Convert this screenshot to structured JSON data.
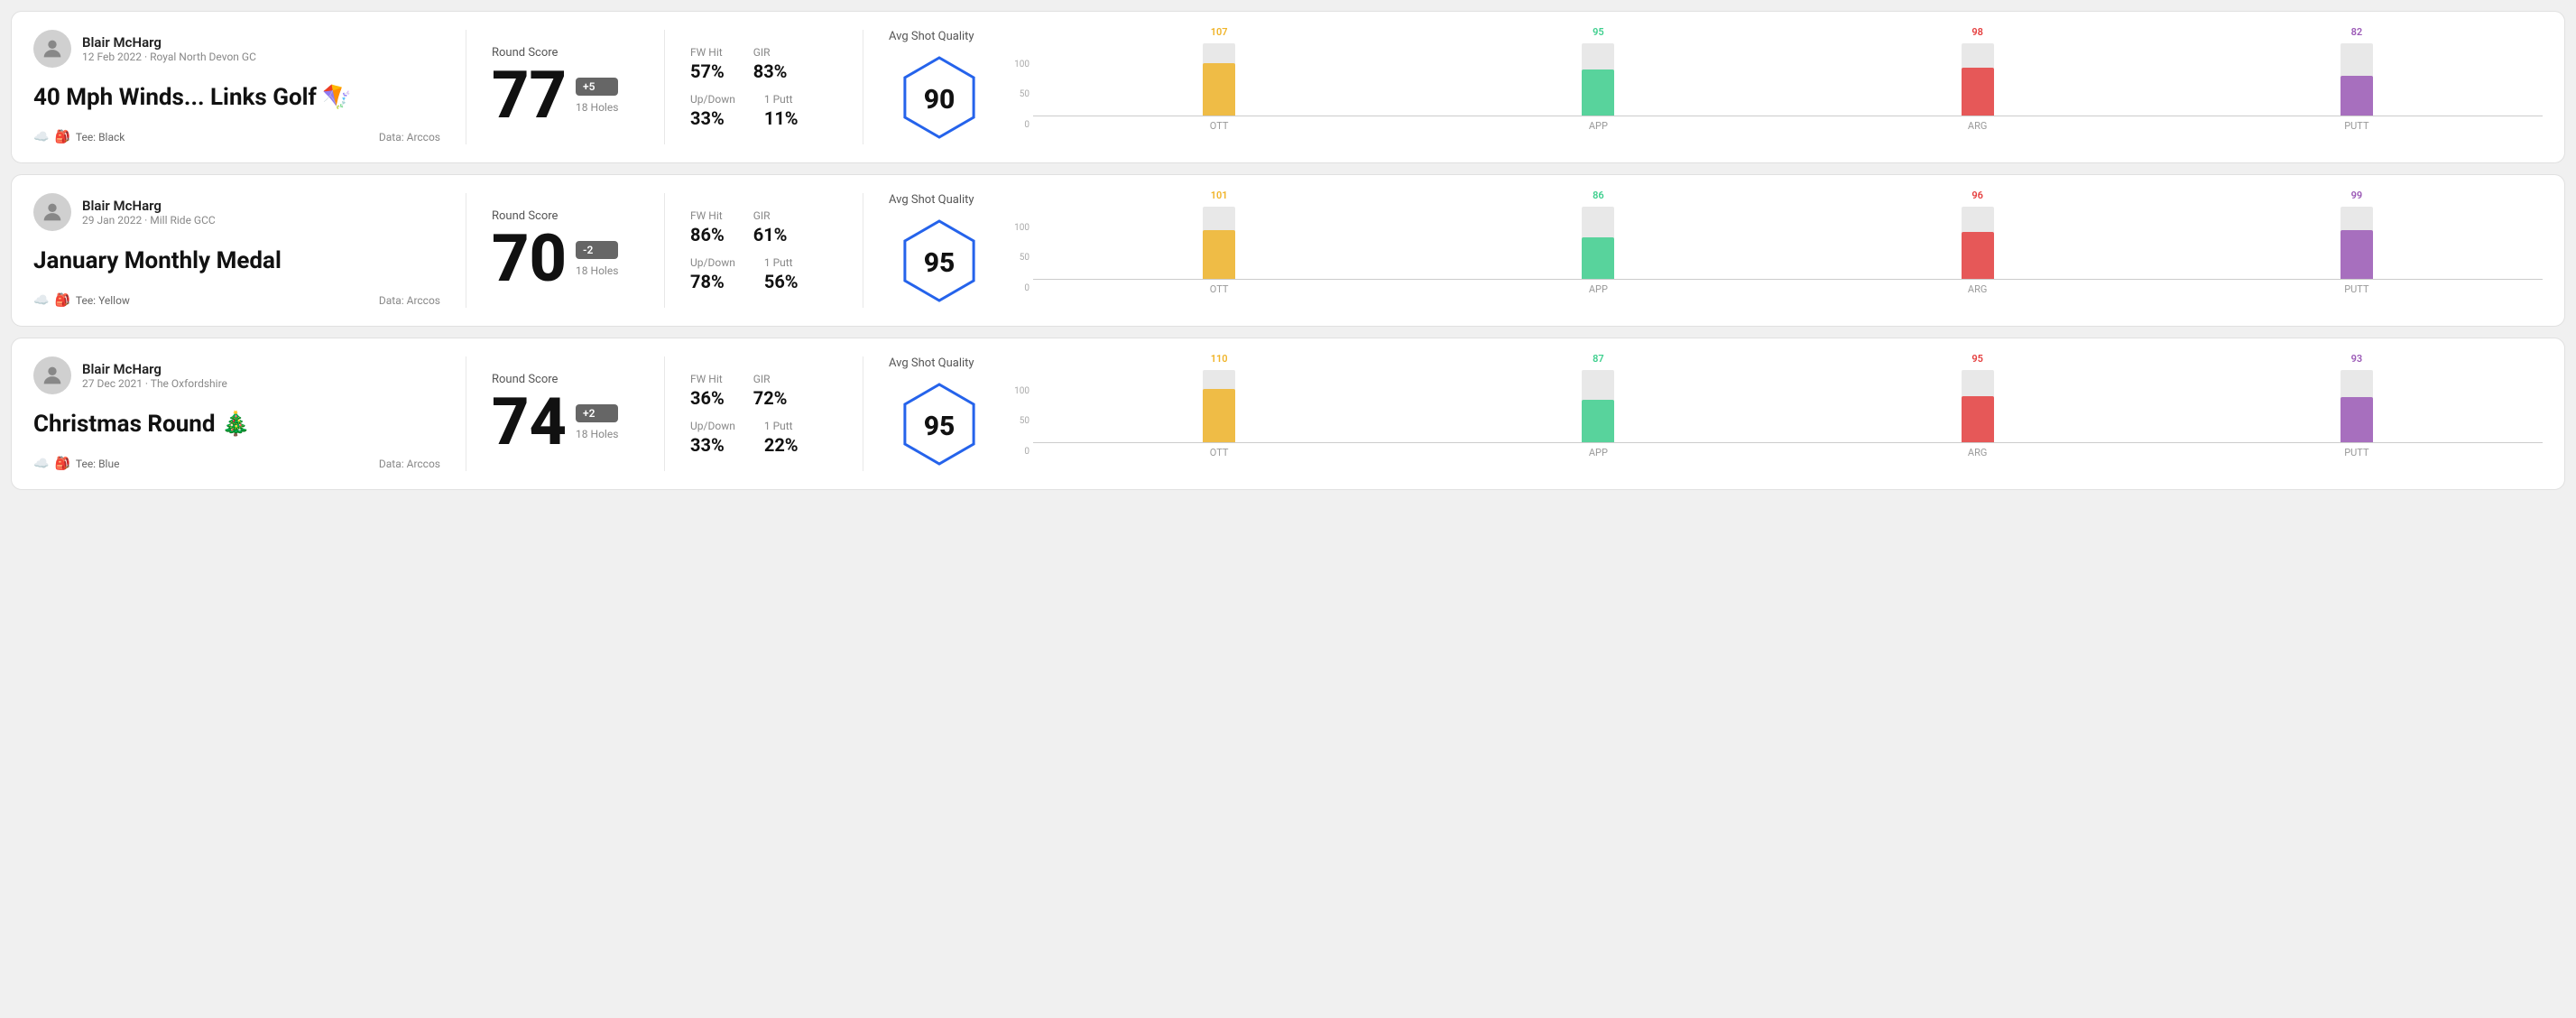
{
  "rounds": [
    {
      "id": "round1",
      "player": {
        "name": "Blair McHarg",
        "meta": "12 Feb 2022 · Royal North Devon GC"
      },
      "title": "40 Mph Winds... Links Golf",
      "title_emoji": "🪁",
      "tee": "Black",
      "data_source": "Data: Arccos",
      "score": {
        "label": "Round Score",
        "number": "77",
        "badge": "+5",
        "badge_type": "positive",
        "holes": "18 Holes"
      },
      "stats": {
        "fw_hit_label": "FW Hit",
        "fw_hit_value": "57%",
        "gir_label": "GIR",
        "gir_value": "83%",
        "updown_label": "Up/Down",
        "updown_value": "33%",
        "oneputt_label": "1 Putt",
        "oneputt_value": "11%"
      },
      "quality": {
        "label": "Avg Shot Quality",
        "score": "90"
      },
      "chart": {
        "bars": [
          {
            "label": "OTT",
            "value": 107,
            "color": "#f0b429",
            "height_pct": 72
          },
          {
            "label": "APP",
            "value": 95,
            "color": "#3ecf8e",
            "height_pct": 64
          },
          {
            "label": "ARG",
            "value": 98,
            "color": "#e53e3e",
            "height_pct": 66
          },
          {
            "label": "PUTT",
            "value": 82,
            "color": "#9b59b6",
            "height_pct": 55
          }
        ],
        "y_labels": [
          "100",
          "50",
          "0"
        ]
      }
    },
    {
      "id": "round2",
      "player": {
        "name": "Blair McHarg",
        "meta": "29 Jan 2022 · Mill Ride GCC"
      },
      "title": "January Monthly Medal",
      "title_emoji": "",
      "tee": "Yellow",
      "data_source": "Data: Arccos",
      "score": {
        "label": "Round Score",
        "number": "70",
        "badge": "-2",
        "badge_type": "negative",
        "holes": "18 Holes"
      },
      "stats": {
        "fw_hit_label": "FW Hit",
        "fw_hit_value": "86%",
        "gir_label": "GIR",
        "gir_value": "61%",
        "updown_label": "Up/Down",
        "updown_value": "78%",
        "oneputt_label": "1 Putt",
        "oneputt_value": "56%"
      },
      "quality": {
        "label": "Avg Shot Quality",
        "score": "95"
      },
      "chart": {
        "bars": [
          {
            "label": "OTT",
            "value": 101,
            "color": "#f0b429",
            "height_pct": 68
          },
          {
            "label": "APP",
            "value": 86,
            "color": "#3ecf8e",
            "height_pct": 58
          },
          {
            "label": "ARG",
            "value": 96,
            "color": "#e53e3e",
            "height_pct": 65
          },
          {
            "label": "PUTT",
            "value": 99,
            "color": "#9b59b6",
            "height_pct": 67
          }
        ],
        "y_labels": [
          "100",
          "50",
          "0"
        ]
      }
    },
    {
      "id": "round3",
      "player": {
        "name": "Blair McHarg",
        "meta": "27 Dec 2021 · The Oxfordshire"
      },
      "title": "Christmas Round",
      "title_emoji": "🎄",
      "tee": "Blue",
      "data_source": "Data: Arccos",
      "score": {
        "label": "Round Score",
        "number": "74",
        "badge": "+2",
        "badge_type": "positive",
        "holes": "18 Holes"
      },
      "stats": {
        "fw_hit_label": "FW Hit",
        "fw_hit_value": "36%",
        "gir_label": "GIR",
        "gir_value": "72%",
        "updown_label": "Up/Down",
        "updown_value": "33%",
        "oneputt_label": "1 Putt",
        "oneputt_value": "22%"
      },
      "quality": {
        "label": "Avg Shot Quality",
        "score": "95"
      },
      "chart": {
        "bars": [
          {
            "label": "OTT",
            "value": 110,
            "color": "#f0b429",
            "height_pct": 74
          },
          {
            "label": "APP",
            "value": 87,
            "color": "#3ecf8e",
            "height_pct": 59
          },
          {
            "label": "ARG",
            "value": 95,
            "color": "#e53e3e",
            "height_pct": 64
          },
          {
            "label": "PUTT",
            "value": 93,
            "color": "#9b59b6",
            "height_pct": 63
          }
        ],
        "y_labels": [
          "100",
          "50",
          "0"
        ]
      }
    }
  ]
}
